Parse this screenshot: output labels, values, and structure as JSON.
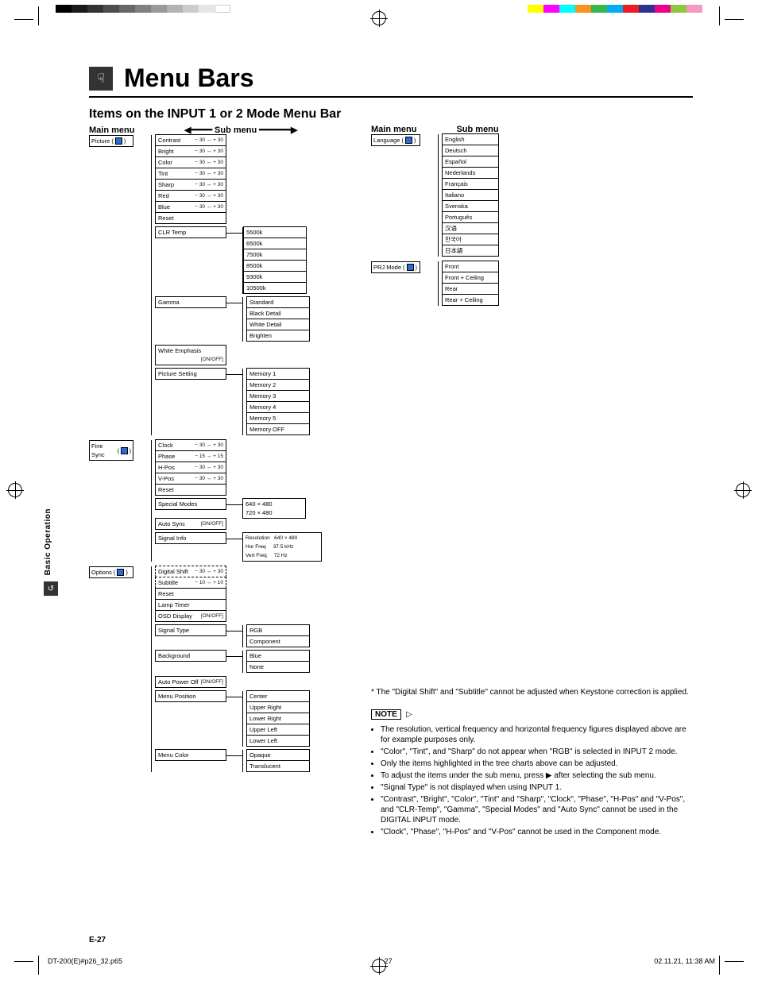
{
  "page_title": "Menu Bars",
  "section_title": "Items on the INPUT 1 or 2 Mode Menu Bar",
  "headers": {
    "main_menu": "Main menu",
    "sub_menu": "Sub menu"
  },
  "left": {
    "picture": {
      "label": "Picture",
      "items": [
        {
          "name": "Contrast",
          "val": "− 30 ↔ + 30"
        },
        {
          "name": "Bright",
          "val": "− 30 ↔ + 30"
        },
        {
          "name": "Color",
          "val": "− 30 ↔ + 30"
        },
        {
          "name": "Tint",
          "val": "− 30 ↔ + 30"
        },
        {
          "name": "Sharp",
          "val": "− 30 ↔ + 30"
        },
        {
          "name": "Red",
          "val": "− 30 ↔ + 30"
        },
        {
          "name": "Blue",
          "val": "− 30 ↔ + 30"
        },
        {
          "name": "Reset",
          "val": ""
        }
      ],
      "clr_temp": {
        "label": "CLR Temp",
        "sub": [
          "5500k",
          "6500k",
          "7500k",
          "8500k",
          "9300k",
          "10500k"
        ]
      },
      "gamma": {
        "label": "Gamma",
        "sub": [
          "Standard",
          "Black Detail",
          "White Detail",
          "Brighten"
        ]
      },
      "white_emphasis": {
        "name": "White Emphasis",
        "val": "[ON/OFF]"
      },
      "picture_setting": {
        "label": "Picture Setting",
        "sub": [
          "Memory 1",
          "Memory 2",
          "Memory 3",
          "Memory 4",
          "Memory 5",
          "Memory OFF"
        ]
      }
    },
    "fine_sync": {
      "label": "Fine Sync",
      "items": [
        {
          "name": "Clock",
          "val": "− 30 ↔ + 30"
        },
        {
          "name": "Phase",
          "val": "− 15 ↔ + 15"
        },
        {
          "name": "H-Pos",
          "val": "− 30 ↔ + 30"
        },
        {
          "name": "V-Pos",
          "val": "− 30 ↔ + 30"
        },
        {
          "name": "Reset",
          "val": ""
        }
      ],
      "special_modes": {
        "label": "Special Modes",
        "sub": [
          "640 × 480",
          "720 × 480"
        ]
      },
      "auto_sync": {
        "name": "Auto Sync",
        "val": "[ON/OFF]"
      },
      "signal_info": {
        "label": "Signal Info",
        "sub": [
          {
            "k": "Resolution",
            "v": "640 × 480"
          },
          {
            "k": "Hor Freq",
            "v": "37.5 kHz"
          },
          {
            "k": "Vert Freq",
            "v": "72 Hz"
          }
        ]
      }
    },
    "options": {
      "label": "Options",
      "digital_shift": {
        "name": "Digital Shift",
        "val": "− 30 ↔ + 30",
        "dashed": true
      },
      "subtitle": {
        "name": "Subtitle",
        "val": "− 10 ↔ + 10",
        "dashed": true
      },
      "items": [
        {
          "name": "Reset",
          "val": ""
        },
        {
          "name": "Lamp Timer",
          "val": ""
        },
        {
          "name": "OSD Display",
          "val": "[ON/OFF]"
        }
      ],
      "signal_type": {
        "label": "Signal Type",
        "sub": [
          "RGB",
          "Component"
        ]
      },
      "background": {
        "label": "Background",
        "sub": [
          "Blue",
          "None"
        ]
      },
      "auto_power_off": {
        "name": "Auto Power Off",
        "val": "[ON/OFF]"
      },
      "menu_position": {
        "label": "Menu Position",
        "sub": [
          "Center",
          "Upper Right",
          "Lower Right",
          "Upper Left",
          "Lower Left"
        ]
      },
      "menu_color": {
        "label": "Menu Color",
        "sub": [
          "Opaque",
          "Translucent"
        ]
      }
    }
  },
  "right": {
    "language": {
      "label": "Language",
      "sub": [
        "English",
        "Deutsch",
        "Español",
        "Nederlands",
        "Français",
        "Italiano",
        "Svenska",
        "Português",
        "汉语",
        "한국어",
        "日本語"
      ]
    },
    "prj_mode": {
      "label": "PRJ Mode",
      "sub": [
        "Front",
        "Front + Ceiling",
        "Rear",
        "Rear + Ceiling"
      ]
    }
  },
  "asterisk_note": "* The \"Digital Shift\" and \"Subtitle\" cannot be adjusted when Keystone correction is applied.",
  "note_label": "NOTE",
  "notes": [
    "The resolution, vertical frequency and horizontal frequency figures displayed above are for example purposes only.",
    "\"Color\", \"Tint\", and \"Sharp\" do not appear when \"RGB\" is selected in INPUT 2 mode.",
    "Only the items highlighted in the tree charts above can be adjusted.",
    "To adjust the items under the sub menu, press ▶ after selecting the sub menu.",
    "\"Signal Type\" is not displayed when using INPUT 1.",
    "\"Contrast\", \"Bright\", \"Color\", \"Tint\" and \"Sharp\", \"Clock\", \"Phase\", \"H-Pos\" and \"V-Pos\", and \"CLR-Temp\", \"Gamma\", \"Special Modes\" and \"Auto Sync\" cannot be used in the DIGITAL INPUT mode.",
    "\"Clock\", \"Phase\", \"H-Pos\" and \"V-Pos\" cannot be used in the Component mode."
  ],
  "side_tab": "Basic Operation",
  "page_number": "E-27",
  "footer": {
    "file": "DT-200(E)#p26_32.p65",
    "page": "27",
    "stamp": "02.11.21, 11:38 AM"
  }
}
